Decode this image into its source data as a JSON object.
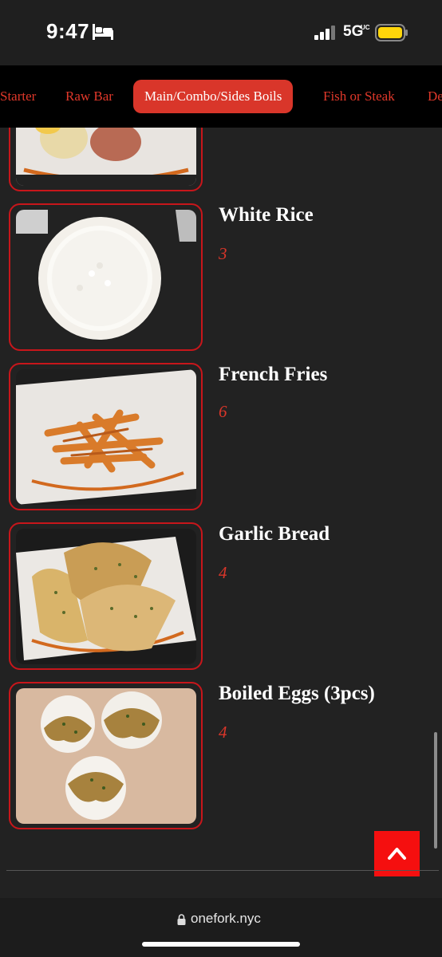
{
  "status_bar": {
    "time": "9:47",
    "focus_icon": "bed-icon",
    "signal_icon": "cellular-signal-icon",
    "network": "5G",
    "network_sub": "UC",
    "battery_icon": "battery-icon"
  },
  "nav": {
    "tabs": [
      {
        "label": "Starter",
        "active": false
      },
      {
        "label": "Raw Bar",
        "active": false
      },
      {
        "label": "Main/Combo/Sides Boils",
        "active": true
      },
      {
        "label": "Fish or Steak",
        "active": false
      },
      {
        "label": "De",
        "active": false
      }
    ]
  },
  "menu": {
    "items": [
      {
        "name": "",
        "price": "",
        "image": "potato-basket"
      },
      {
        "name": "White Rice",
        "price": "3",
        "image": "white-rice"
      },
      {
        "name": "French Fries",
        "price": "6",
        "image": "french-fries"
      },
      {
        "name": "Garlic Bread",
        "price": "4",
        "image": "garlic-bread"
      },
      {
        "name": "Boiled Eggs (3pcs)",
        "price": "4",
        "image": "boiled-eggs"
      }
    ]
  },
  "back_to_top_icon": "chevron-up-icon",
  "browser": {
    "url": "onefork.nyc",
    "lock_icon": "lock-icon"
  },
  "colors": {
    "accent": "#d9362a",
    "card_border": "#c8161b",
    "back_to_top": "#f50f0f",
    "background": "#222222"
  }
}
